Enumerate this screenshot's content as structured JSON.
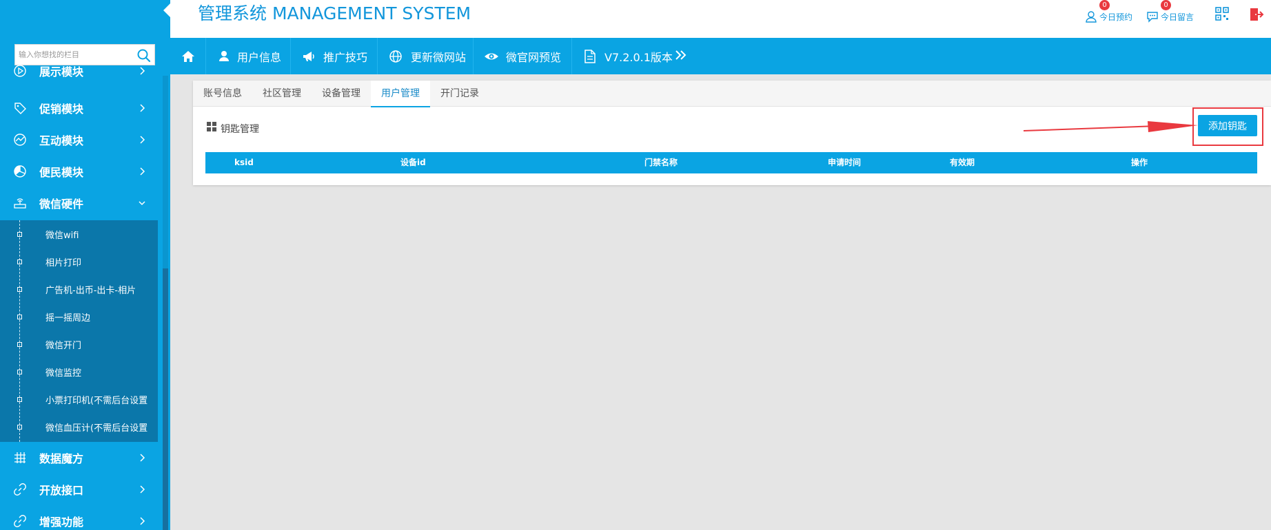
{
  "app": {
    "title": "管理系统 MANAGEMENT SYSTEM"
  },
  "search": {
    "placeholder": "输入你想找的栏目"
  },
  "header_links": [
    {
      "label": "今日预约",
      "badge": "0",
      "icon": "user-icon"
    },
    {
      "label": "今日留言",
      "badge": "0",
      "icon": "chat-icon"
    },
    {
      "label": "",
      "icon": "qrcode-icon"
    },
    {
      "label": "",
      "icon": "logout-icon"
    }
  ],
  "nav": {
    "items": [
      {
        "label": "",
        "icon": "home-icon"
      },
      {
        "label": "用户信息",
        "icon": "user-icon"
      },
      {
        "label": "推广技巧",
        "icon": "megaphone-icon"
      },
      {
        "label": "更新微网站",
        "icon": "globe-icon"
      },
      {
        "label": "微官网预览",
        "icon": "eye-icon"
      },
      {
        "label": "V7.2.0.1版本",
        "icon": "document-icon"
      }
    ]
  },
  "sidebar": {
    "items": [
      {
        "label": "展示模块",
        "icon": "play-circle-icon"
      },
      {
        "label": "促销模块",
        "icon": "tag-icon"
      },
      {
        "label": "互动模块",
        "icon": "activity-icon"
      },
      {
        "label": "便民模块",
        "icon": "pie-icon"
      },
      {
        "label": "微信硬件",
        "icon": "router-icon",
        "expanded": true
      },
      {
        "label": "数据魔方",
        "icon": "grid-icon"
      },
      {
        "label": "开放接口",
        "icon": "link-icon"
      },
      {
        "label": "增强功能",
        "icon": "link-icon"
      }
    ],
    "subitems": [
      "微信wifi",
      "相片打印",
      "广告机-出币-出卡-相片",
      "摇一摇周边",
      "微信开门",
      "微信监控",
      "小票打印机(不需后台设置",
      "微信血压计(不需后台设置"
    ]
  },
  "tabs": [
    {
      "label": "账号信息",
      "active": false
    },
    {
      "label": "社区管理",
      "active": false
    },
    {
      "label": "设备管理",
      "active": false
    },
    {
      "label": "用户管理",
      "active": true
    },
    {
      "label": "开门记录",
      "active": false
    }
  ],
  "section": {
    "title": "钥匙管理",
    "add_button": "添加钥匙"
  },
  "table": {
    "columns": [
      "ksid",
      "设备id",
      "门禁名称",
      "申请时间",
      "有效期",
      "操作"
    ]
  },
  "colors": {
    "primary": "#0aa4e3",
    "submenu": "#0b77aa",
    "highlight": "#e9393f"
  }
}
